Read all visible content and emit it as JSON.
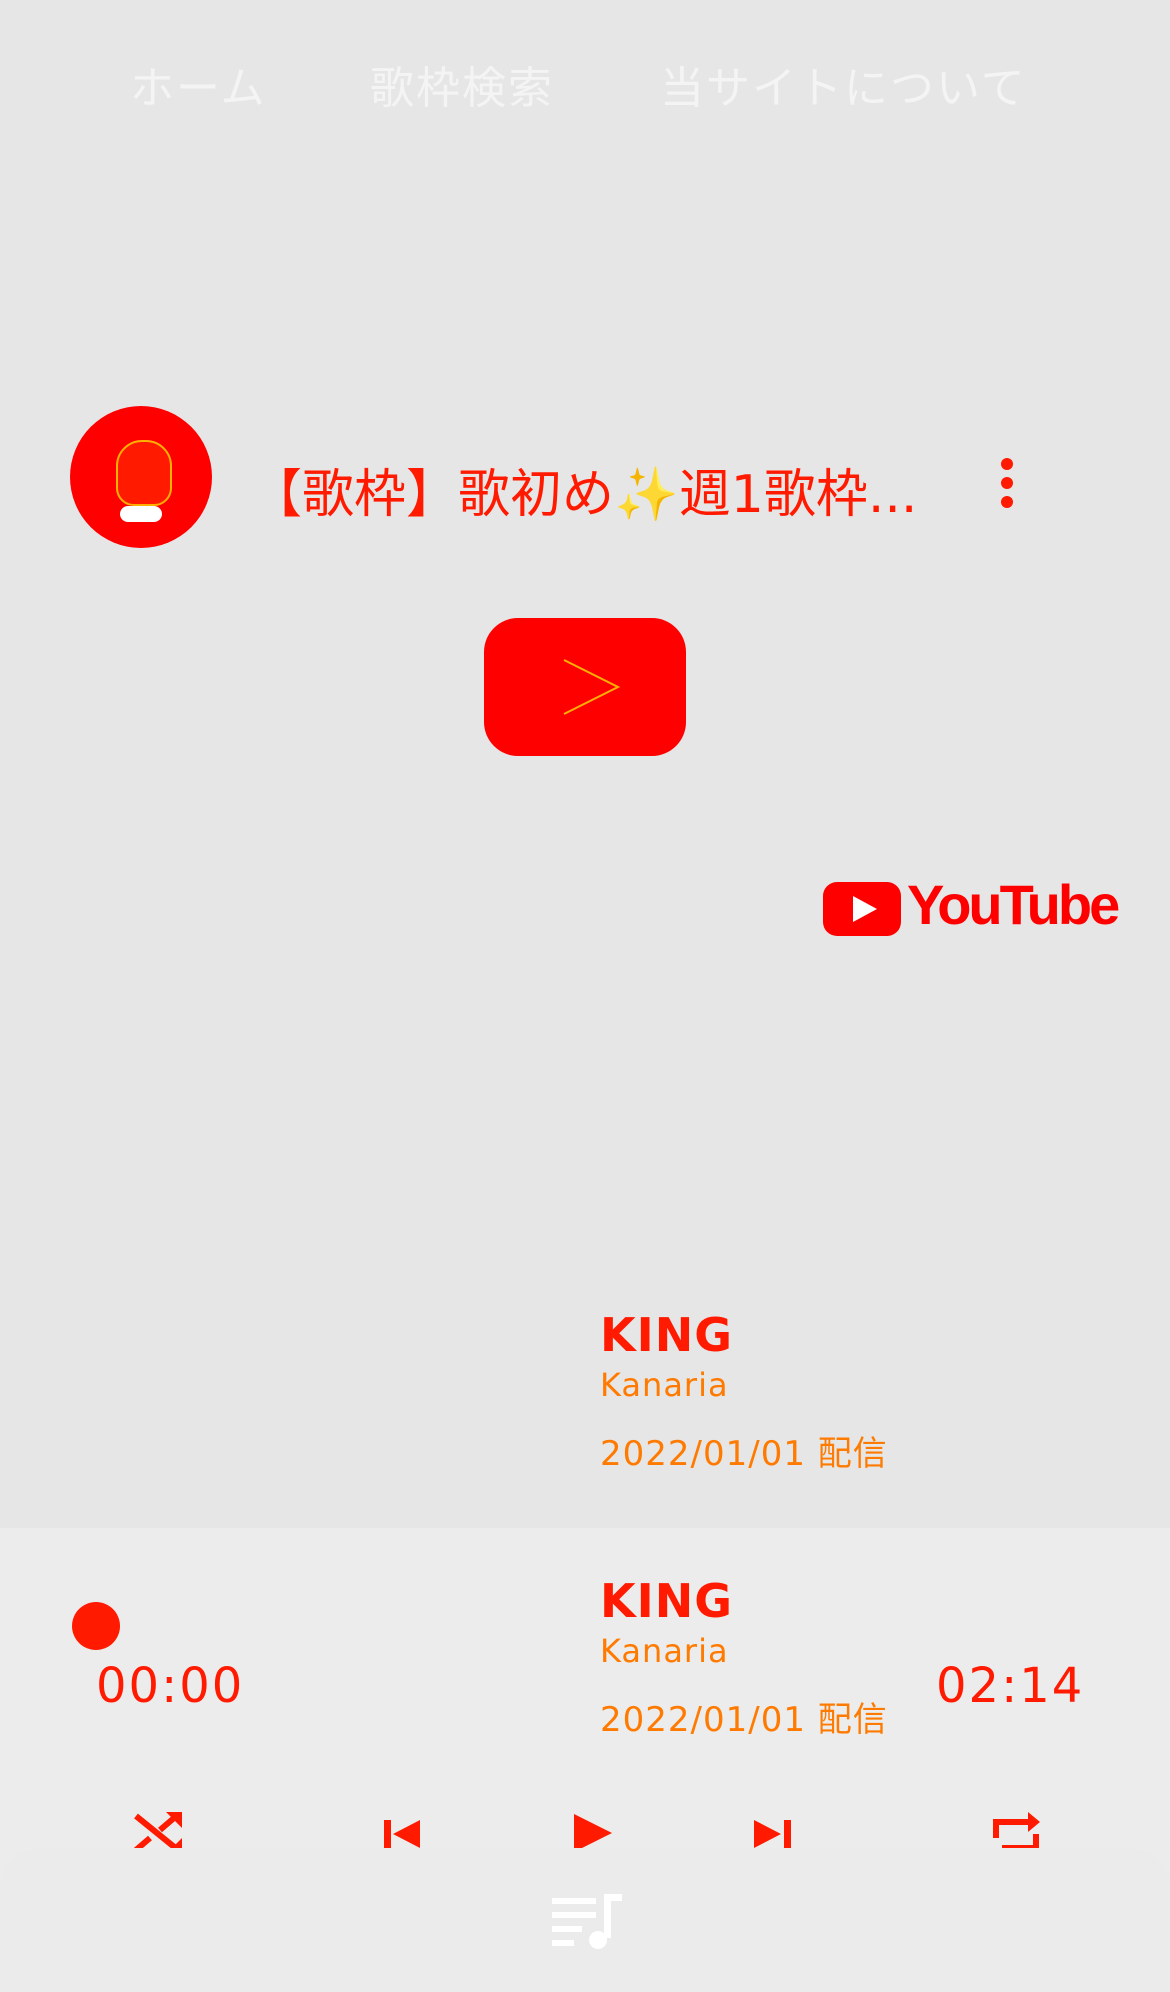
{
  "nav": {
    "items": [
      {
        "label": "ホーム"
      },
      {
        "label": "歌枠検索"
      },
      {
        "label": "当サイトについて"
      }
    ]
  },
  "video": {
    "title": "【歌枠】歌初め✨週1歌枠...",
    "brand": "YouTube"
  },
  "now_playing": {
    "title": "KING",
    "artist": "Kanaria",
    "date": "2022/01/01 配信"
  },
  "player": {
    "song": {
      "title": "KING",
      "artist": "Kanaria",
      "date": "2022/01/01 配信"
    },
    "elapsed": "00:00",
    "duration": "02:14",
    "progress": 0
  },
  "icons": [
    "shuffle-icon",
    "skip-previous-icon",
    "play-icon",
    "skip-next-icon",
    "repeat-icon",
    "queue-music-icon"
  ],
  "colors": {
    "accent": "#ff1a00",
    "secondary": "#ff7a00",
    "background": "#e6e6e6"
  }
}
